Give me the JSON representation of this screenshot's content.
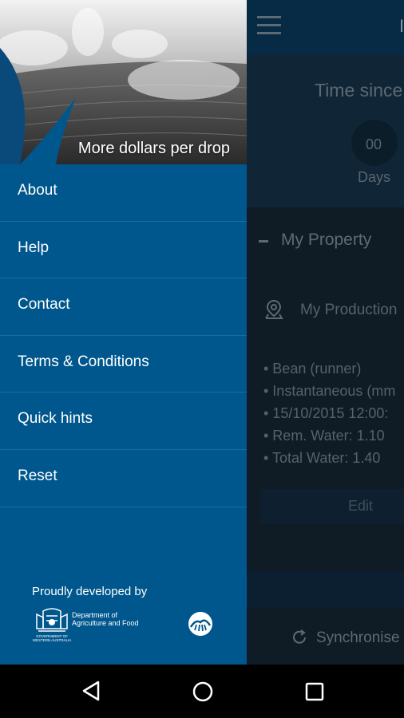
{
  "app": {
    "appbar_title_fragment": "I",
    "timer": {
      "title": "Time since",
      "days_value": "00",
      "days_label": "Days"
    },
    "property_section": {
      "title": "My Property"
    },
    "production": {
      "title": "My Production",
      "details": [
        "• Bean (runner)",
        "• Instantaneous (mm",
        "• 15/10/2015 12:00:",
        "• Rem. Water: 1.10",
        "• Total Water: 1.40"
      ],
      "edit_label": "Edit"
    },
    "sync_label": "Synchronise"
  },
  "drawer": {
    "tagline": "More dollars per drop",
    "menu": [
      {
        "label": "About"
      },
      {
        "label": "Help"
      },
      {
        "label": "Contact"
      },
      {
        "label": "Terms & Conditions"
      },
      {
        "label": "Quick hints"
      },
      {
        "label": "Reset"
      }
    ],
    "footer": {
      "developed_by": "Proudly developed by",
      "dept_line1": "Department of",
      "dept_line2": "Agriculture and Food",
      "crest_caption1": "GOVERNMENT OF",
      "crest_caption2": "WESTERN AUSTRALIA"
    }
  },
  "colors": {
    "drawer_bg": "#00578d",
    "scrim": "#0f1b25",
    "navbar": "#000000"
  },
  "icons": {
    "menu": "hamburger-icon",
    "collapse": "minus-icon",
    "location": "map-pin-icon",
    "sync": "refresh-icon",
    "nav": [
      "back-triangle-icon",
      "home-circle-icon",
      "recents-square-icon"
    ]
  }
}
